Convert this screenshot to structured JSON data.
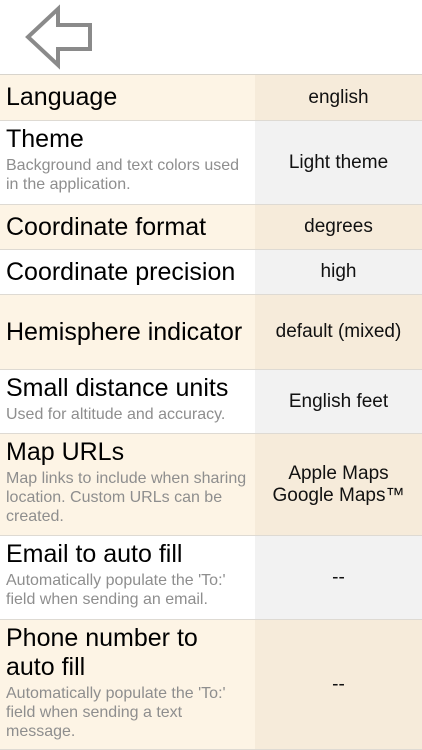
{
  "header": {
    "back_icon": "back-arrow-icon"
  },
  "settings": [
    {
      "title": "Language",
      "description": "",
      "value": "english"
    },
    {
      "title": "Theme",
      "description": "Background and text colors used in the application.",
      "value": "Light theme"
    },
    {
      "title": "Coordinate format",
      "description": "",
      "value": "degrees"
    },
    {
      "title": "Coordinate precision",
      "description": "",
      "value": "high"
    },
    {
      "title": "Hemisphere indicator",
      "description": "",
      "value": "default (mixed)"
    },
    {
      "title": "Small distance units",
      "description": "Used for altitude and accuracy.",
      "value": "English feet"
    },
    {
      "title": "Map URLs",
      "description": "Map links to include when sharing location.  Custom URLs can be created.",
      "value": "Apple Maps",
      "value2": "Google Maps™"
    },
    {
      "title": "Email to auto fill",
      "description": "Automatically populate the 'To:' field when sending an email.",
      "value": "--"
    },
    {
      "title": "Phone number to auto fill",
      "description": "Automatically populate the 'To:' field when sending a text message.",
      "value": "--"
    }
  ]
}
